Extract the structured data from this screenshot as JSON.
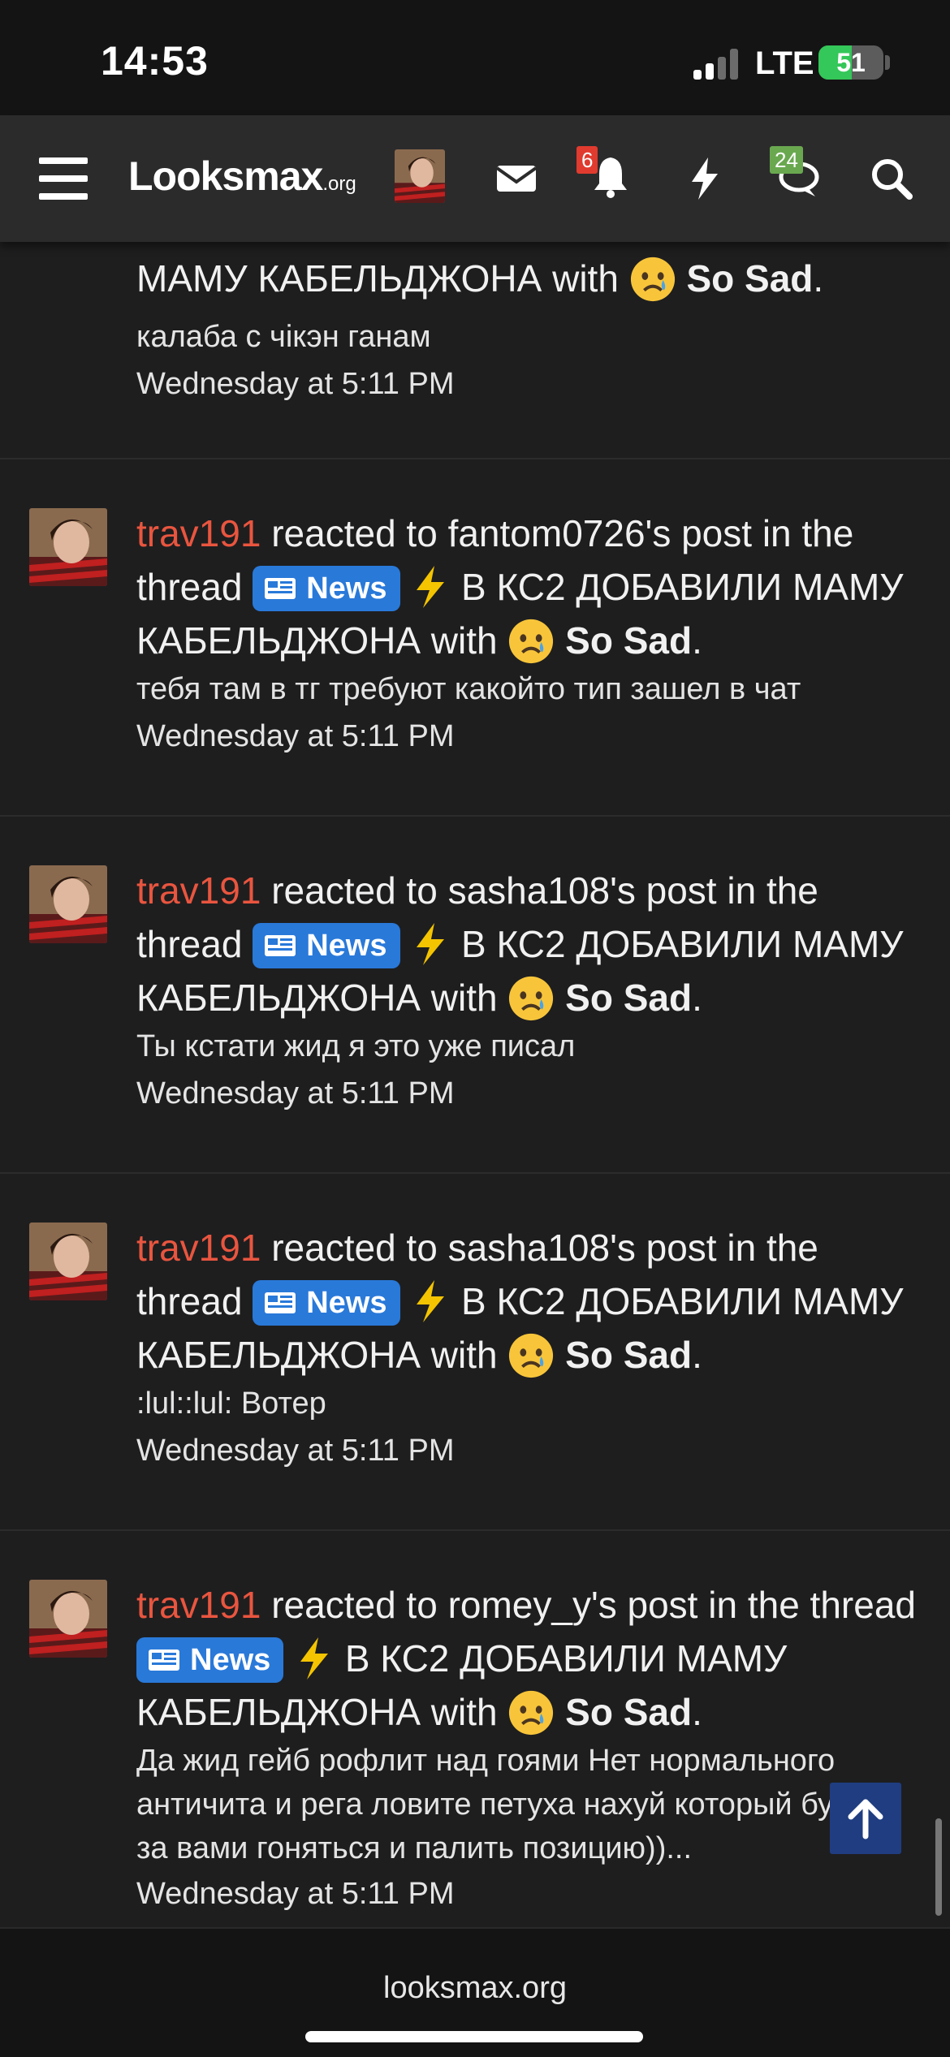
{
  "status_bar": {
    "time": "14:53",
    "network": "LTE",
    "battery": "51",
    "battery_level_percent": 51
  },
  "navbar": {
    "logo_main": "Looksmax",
    "logo_suffix": ".org",
    "notifications_badge": "6",
    "conversations_badge": "24",
    "icons": [
      "menu-icon",
      "envelope-icon",
      "bell-icon",
      "bolt-icon",
      "chat-icon",
      "search-icon"
    ]
  },
  "alerts": [
    {
      "user": "",
      "action": "",
      "line_partial": "МАМУ КАБЕЛЬДЖОНА with",
      "reaction": "So Sad",
      "snippet": "калаба с чікэн ганам",
      "time": "Wednesday at 5:11 PM"
    },
    {
      "user": "trav191",
      "action": " reacted to fantom0726's post in the thread ",
      "tag": "News",
      "thread": " В КС2 ДОБАВИЛИ МАМУ КАБЕЛЬДЖОНА with ",
      "reaction": "So Sad",
      "snippet": "тебя там в тг требуют какойто тип зашел в чат",
      "time": "Wednesday at 5:11 PM"
    },
    {
      "user": "trav191",
      "action": " reacted to sasha108's post in the thread ",
      "tag": "News",
      "thread": " В КС2 ДОБАВИЛИ МАМУ КАБЕЛЬДЖОНА with ",
      "reaction": "So Sad",
      "snippet": "Ты кстати жид я это уже писал",
      "time": "Wednesday at 5:11 PM"
    },
    {
      "user": "trav191",
      "action": " reacted to sasha108's post in the thread ",
      "tag": "News",
      "thread": " В КС2 ДОБАВИЛИ МАМУ КАБЕЛЬДЖОНА with ",
      "reaction": "So Sad",
      "snippet": ":lul::lul: Вотер",
      "time": "Wednesday at 5:11 PM"
    },
    {
      "user": "trav191",
      "action": " reacted to romey_y's post in the thread ",
      "tag": "News",
      "thread": " В КС2 ДОБАВИЛИ МАМУ КАБЕЛЬДЖОНА with ",
      "reaction": "So Sad",
      "snippet": "Да жид гейб рофлит над гоями Нет нормального античита и рега ловите петуха нахуй который будет за вами гоняться и палить позицию))...",
      "time": "Wednesday at 5:11 PM"
    }
  ],
  "footer": {
    "link": "looksmax.org"
  },
  "colors": {
    "username": "#e9553f",
    "news_tag": "#2979d9",
    "background": "#1e1e1f"
  }
}
